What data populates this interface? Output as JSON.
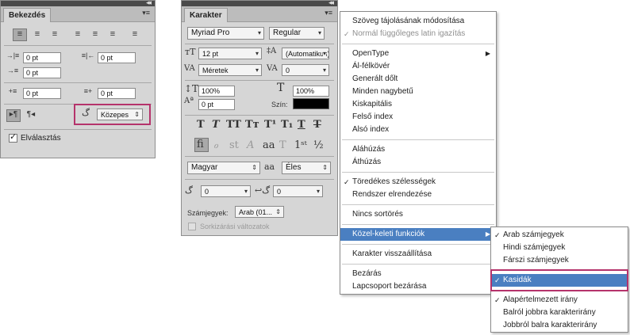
{
  "paragraph_panel": {
    "tab": "Bekezdés",
    "indent_left": "0 pt",
    "indent_right": "0 pt",
    "indent_first": "0 pt",
    "space_before": "0 pt",
    "space_after": "0 pt",
    "kashida_value": "Közepes",
    "hyphenation_label": "Elválasztás"
  },
  "character_panel": {
    "tab": "Karakter",
    "font_family": "Myriad Pro",
    "font_style": "Regular",
    "font_size": "12 pt",
    "leading": "(Automatikus)",
    "kerning": "Méretek",
    "tracking": "0",
    "vertical_scale": "100%",
    "horizontal_scale": "100%",
    "baseline_shift": "0 pt",
    "color_label": "Szín:",
    "language": "Magyar",
    "antialias_glyph": "aa",
    "antialias": "Éles",
    "kashida_a": "0",
    "kashida_b": "0",
    "digits_label": "Számjegyek:",
    "digits_value": "Arab (01...",
    "ordinal_label": "Sorkizárási változatok"
  },
  "main_menu": {
    "items": [
      "Szöveg tájolásának módosítása",
      "Normál függőleges latin igazítás",
      "OpenType",
      "Ál-félkövér",
      "Generált dőlt",
      "Minden nagybetű",
      "Kiskapitális",
      "Felső index",
      "Alsó index",
      "Aláhúzás",
      "Áthúzás",
      "Töredékes szélességek",
      "Rendszer elrendezése",
      "Nincs sortörés",
      "Közel-keleti funkciók",
      "Karakter visszaállítása",
      "Bezárás",
      "Lapcsoport bezárása"
    ]
  },
  "sub_menu": {
    "items": [
      "Arab számjegyek",
      "Hindi számjegyek",
      "Fárszi számjegyek",
      "Kasidák",
      "Alapértelmezett irány",
      "Balról jobbra karakterirány",
      "Jobbról balra karakterirány"
    ]
  },
  "colors": {
    "highlight": "#4a7fc1",
    "callout": "#b5336b",
    "panel": "#d6d6d6",
    "tabbar": "#bcbcbc"
  }
}
